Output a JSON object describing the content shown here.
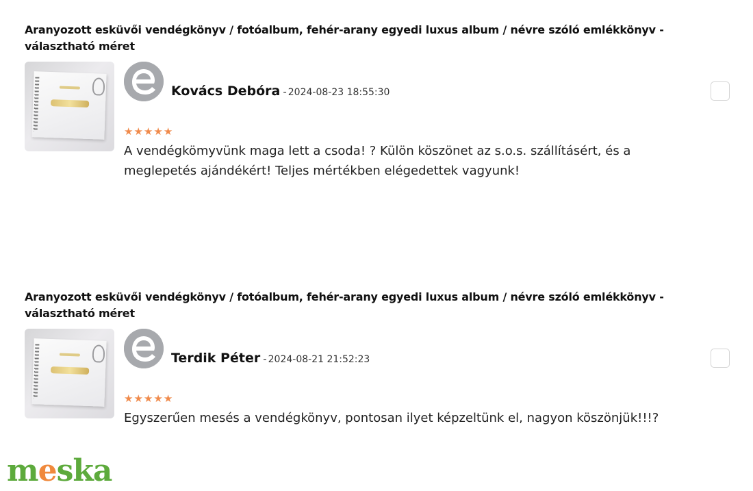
{
  "reviews": [
    {
      "product_title": "Aranyozott esküvői vendégkönyv / fotóalbum, fehér-arany egyedi luxus album / névre szóló emlékkönyv - választható méret",
      "reviewer_name": "Kovács Debóra",
      "separator": "-",
      "date": "2024-08-23 18:55:30",
      "rating": 5,
      "text": "A vendégkömyvünk maga lett a csoda! ? Külön köszönet az s.o.s. szállításért, és a meglepetés ajándékért! Teljes mértékben elégedettek vagyunk!"
    },
    {
      "product_title": "Aranyozott esküvői vendégkönyv / fotóalbum, fehér-arany egyedi luxus album / névre szóló emlékkönyv - választható méret",
      "reviewer_name": "Terdik Péter",
      "separator": "-",
      "date": "2024-08-21 21:52:23",
      "rating": 5,
      "text": "Egyszerűen mesés a vendégkönyv, pontosan ilyet képzeltünk el, nagyon köszönjük!!!?"
    }
  ],
  "icons": {
    "star": "star-icon",
    "avatar": "default-avatar-icon"
  },
  "logo": {
    "part1": "m",
    "part2": "e",
    "part3": "ska"
  },
  "colors": {
    "star": "#f08a4b",
    "avatar_bg": "#a7a9ad",
    "logo_green": "#5daa3c",
    "logo_orange": "#f0893c"
  }
}
